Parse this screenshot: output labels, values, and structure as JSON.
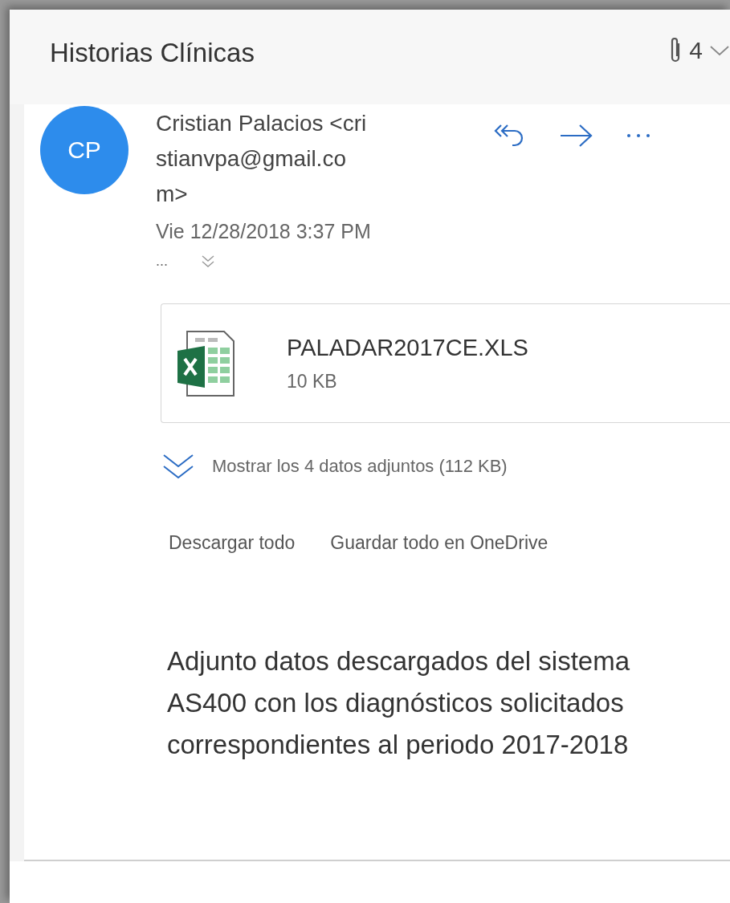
{
  "header": {
    "title": "Historias Clínicas",
    "attachment_count": "4"
  },
  "message": {
    "avatar_initials": "CP",
    "sender_lines": [
      "Cristian Palacios <cri",
      "stianvpa@gmail.co",
      "m>"
    ],
    "date": "Vie 12/28/2018 3:37 PM",
    "more": "...",
    "attachment": {
      "name": "PALADAR2017CE.XLS",
      "size": "10 KB"
    },
    "show_all": "Mostrar los 4 datos adjuntos (112 KB)",
    "actions": [
      "Descargar todo",
      "Guardar todo en OneDrive"
    ],
    "body": "Adjunto datos descargados del sistema AS400 con los diagnósticos solicitados correspondientes al periodo 2017-2018"
  }
}
